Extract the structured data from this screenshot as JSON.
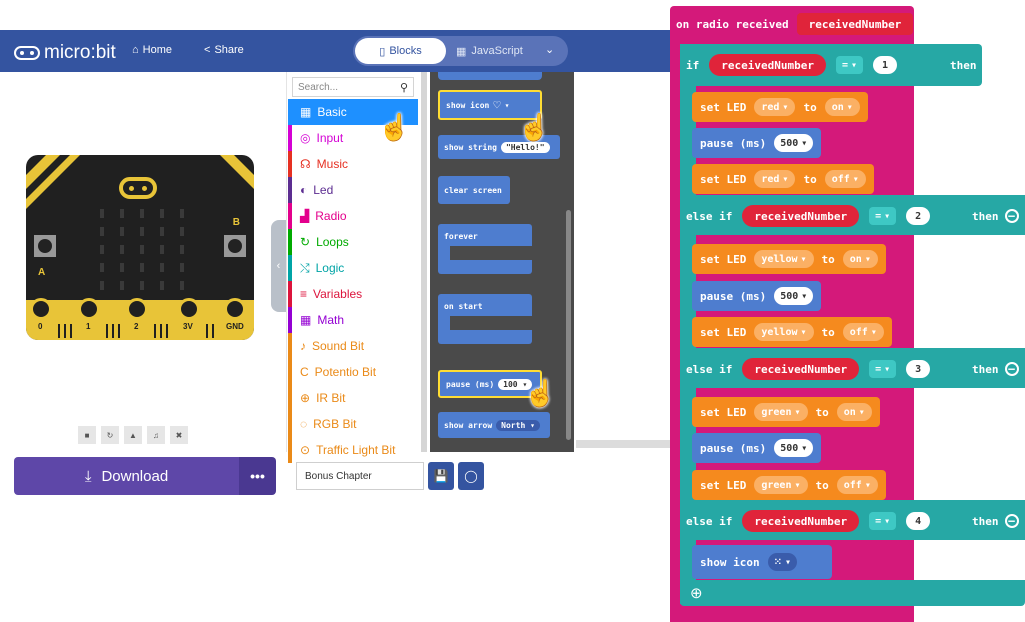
{
  "header": {
    "logo": "micro:bit",
    "home": "Home",
    "share": "Share",
    "blocks_tab": "Blocks",
    "js_tab": "JavaScript"
  },
  "simulator": {
    "pin_labels": [
      "0",
      "1",
      "2",
      "3V",
      "GND"
    ],
    "button_a": "A",
    "button_b": "B"
  },
  "toolbox": {
    "search_placeholder": "Search...",
    "categories": [
      {
        "label": "Basic",
        "color": "#1e90ff",
        "icon": "grid-icon"
      },
      {
        "label": "Input",
        "color": "#d400d4",
        "icon": "target-icon"
      },
      {
        "label": "Music",
        "color": "#e63022",
        "icon": "headphones-icon"
      },
      {
        "label": "Led",
        "color": "#5c2d91",
        "icon": "toggle-icon"
      },
      {
        "label": "Radio",
        "color": "#e3008c",
        "icon": "signal-icon"
      },
      {
        "label": "Loops",
        "color": "#00aa00",
        "icon": "loop-icon"
      },
      {
        "label": "Logic",
        "color": "#00a4a6",
        "icon": "shuffle-icon"
      },
      {
        "label": "Variables",
        "color": "#dc143c",
        "icon": "list-icon"
      },
      {
        "label": "Math",
        "color": "#9400d3",
        "icon": "calculator-icon"
      },
      {
        "label": "Sound Bit",
        "color": "#ea8a18",
        "icon": "mic-icon"
      },
      {
        "label": "Potentio Bit",
        "color": "#ea8a18",
        "icon": "c-icon"
      },
      {
        "label": "IR Bit",
        "color": "#ea8a18",
        "icon": "crosshair-icon"
      },
      {
        "label": "RGB Bit",
        "color": "#ea8a18",
        "icon": "dotted-circle-icon"
      },
      {
        "label": "Traffic Light Bit",
        "color": "#ea8a18",
        "icon": "traffic-icon"
      }
    ]
  },
  "flyout": {
    "show_icon": "show icon",
    "show_string": "show string",
    "show_string_value": "\"Hello!\"",
    "clear_screen": "clear screen",
    "forever": "forever",
    "on_start": "on start",
    "pause": "pause (ms)",
    "pause_value": "100",
    "show_arrow": "show arrow",
    "arrow_value": "North"
  },
  "bottom": {
    "download": "Download",
    "more": "•••",
    "project_name": "Bonus Chapter"
  },
  "program": {
    "event": "on radio received",
    "event_var": "receivedNumber",
    "kw_if": "if",
    "kw_then": "then",
    "kw_else_if": "else if",
    "var": "receivedNumber",
    "op": "=",
    "set_led": "set LED",
    "to": "to",
    "pause": "pause (ms)",
    "pause_value": "500",
    "show_icon": "show icon",
    "branches": [
      {
        "num": "1",
        "color": "red"
      },
      {
        "num": "2",
        "color": "yellow"
      },
      {
        "num": "3",
        "color": "green"
      },
      {
        "num": "4"
      }
    ],
    "on": "on",
    "off": "off"
  },
  "colors": {
    "header": "#3454a0",
    "event": "#d4197a",
    "logic": "#26a8a5",
    "led": "#f58a1e",
    "basic": "#4e7dcf",
    "download": "#5e47a8"
  }
}
